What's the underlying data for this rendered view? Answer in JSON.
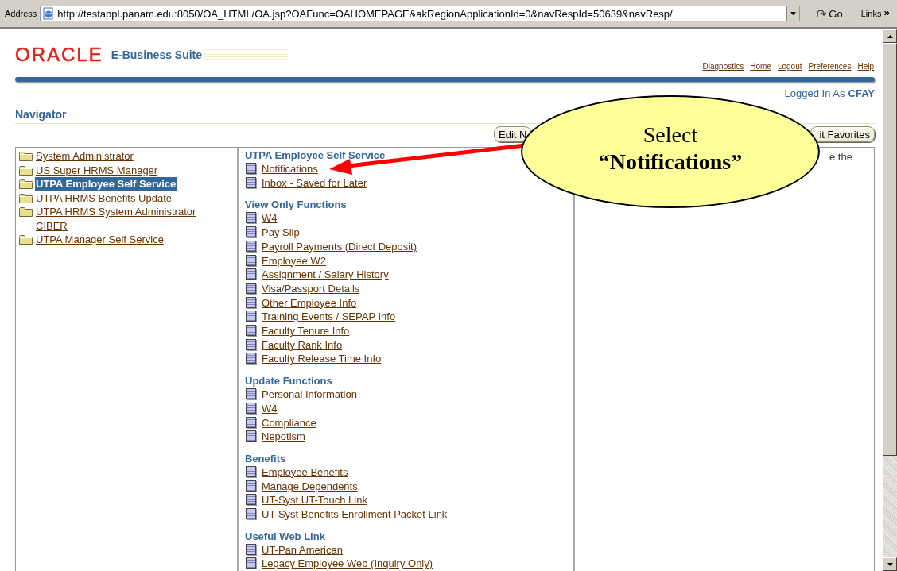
{
  "address_bar": {
    "label": "Address",
    "url": "http://testappl.panam.edu:8050/OA_HTML/OA.jsp?OAFunc=OAHOMEPAGE&akRegionApplicationId=0&navRespId=50639&navResp/",
    "go": "Go",
    "links": "Links",
    "chevron": "»"
  },
  "header": {
    "logo": "ORACLE",
    "product": "E-Business Suite",
    "global_links": [
      "Diagnostics",
      "Home",
      "Logout",
      "Preferences",
      "Help"
    ],
    "logged_in_label": "Logged In As",
    "user": "CFAY"
  },
  "navigator": {
    "title": "Navigator",
    "buttons": [
      "Edit N",
      "it Favorites"
    ],
    "responsibilities": [
      {
        "label": "System Administrator",
        "selected": false
      },
      {
        "label": "US Super HRMS Manager",
        "selected": false
      },
      {
        "label": "UTPA Employee Self Service",
        "selected": true
      },
      {
        "label": "UTPA HRMS Benefits Update",
        "selected": false
      },
      {
        "label": "UTPA HRMS System Administrator CIBER",
        "selected": false
      },
      {
        "label": "UTPA Manager Self Service",
        "selected": false
      }
    ],
    "sections": [
      {
        "heading": "UTPA Employee Self Service",
        "items": [
          "Notifications",
          "Inbox - Saved for Later"
        ]
      },
      {
        "heading": "View Only Functions",
        "items": [
          "W4",
          "Pay Slip",
          "Payroll Payments (Direct Deposit)",
          "Employee W2",
          "Assignment / Salary History",
          "Visa/Passport Details",
          "Other Employee Info",
          "Training Events / SEPAP Info",
          "Faculty Tenure Info",
          "Faculty Rank Info",
          "Faculty Release Time Info"
        ]
      },
      {
        "heading": "Update Functions",
        "items": [
          "Personal Information",
          "W4",
          "Compliance",
          "Nepotism"
        ]
      },
      {
        "heading": "Benefits",
        "items": [
          "Employee Benefits",
          "Manage Dependents",
          "UT-Syst UT-Touch Link",
          "UT-Syst Benefits Enrollment Packet Link"
        ]
      },
      {
        "heading": "Useful Web Link",
        "items": [
          "UT-Pan American",
          "Legacy Employee Web (Inquiry Only)"
        ]
      }
    ],
    "right_text": "e the"
  },
  "callout": {
    "line1": "Select",
    "line2": "“Notifications”"
  }
}
